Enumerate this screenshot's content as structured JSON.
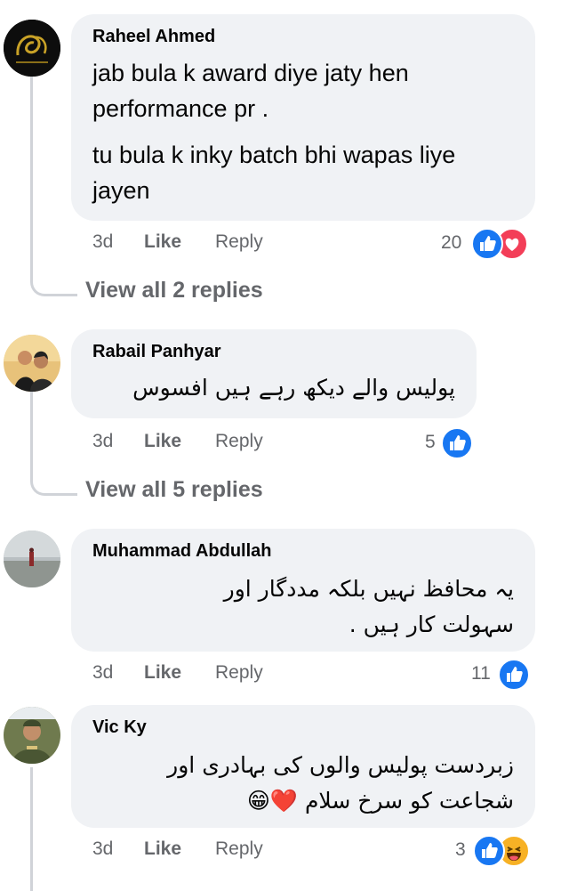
{
  "comments": [
    {
      "author": "Raheel Ahmed",
      "paragraphs": [
        "jab bula k award diye jaty hen performance pr .",
        "tu bula k inky batch bhi wapas liye jayen"
      ],
      "time": "3d",
      "like": "Like",
      "reply": "Reply",
      "reaction_count": "20",
      "reactions": [
        "like-icon",
        "love-icon"
      ],
      "view_replies": "View all 2 replies"
    },
    {
      "author": "Rabail Panhyar",
      "paragraphs": [
        "پولیس والے دیکھ رہے ہیں افسوس"
      ],
      "time": "3d",
      "like": "Like",
      "reply": "Reply",
      "reaction_count": "5",
      "reactions": [
        "like-icon"
      ],
      "view_replies": "View all 5 replies"
    },
    {
      "author": "Muhammad Abdullah",
      "paragraphs": [
        "یہ محافظ نہیں بلکہ مددگار اور سہولت کار ہیں ."
      ],
      "time": "3d",
      "like": "Like",
      "reply": "Reply",
      "reaction_count": "11",
      "reactions": [
        "like-icon"
      ]
    },
    {
      "author": "Vic Ky",
      "paragraphs": [
        "زبردست پولیس والوں کی بہادری اور شجاعت کو سرخ سلام ❤️😁"
      ],
      "time": "3d",
      "like": "Like",
      "reply": "Reply",
      "reaction_count": "3",
      "reactions": [
        "like-icon",
        "haha-icon"
      ]
    }
  ],
  "colors": {
    "bubble": "#f0f2f5",
    "meta": "#65676b",
    "like_blue": "#1877f2",
    "love_red": "#f33e58",
    "haha_yellow": "#f7b125"
  }
}
